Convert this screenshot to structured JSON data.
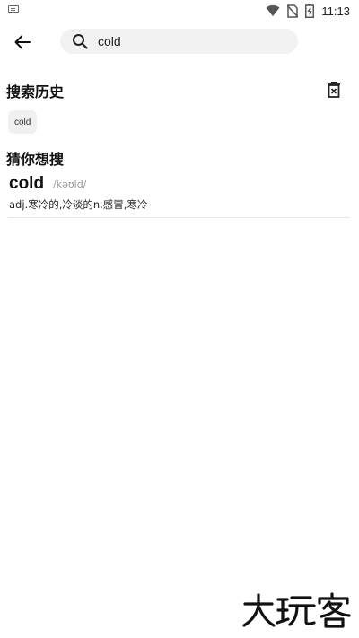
{
  "status_bar": {
    "time": "11:13",
    "icons": [
      "keyboard-icon",
      "wifi-icon",
      "no-sim-icon",
      "battery-icon"
    ]
  },
  "search": {
    "query": "cold",
    "icons": [
      "back-arrow-icon",
      "search-icon"
    ]
  },
  "history": {
    "title": "搜索历史",
    "delete_icon": "trash-icon",
    "items": [
      "cold"
    ]
  },
  "guess": {
    "title": "猜你想搜",
    "results": [
      {
        "word": "cold",
        "phonetic": "/kəʊld/",
        "definition": "adj.寒冷的,冷淡的n.感冒,寒冷"
      }
    ]
  },
  "watermark": {
    "text": "大玩客",
    "kind": "logo"
  },
  "colors": {
    "background": "#ffffff",
    "search_box": "#f2f2f2",
    "chip": "#f0f0f0",
    "divider": "#e6e6e6",
    "phonetic": "#999999"
  }
}
